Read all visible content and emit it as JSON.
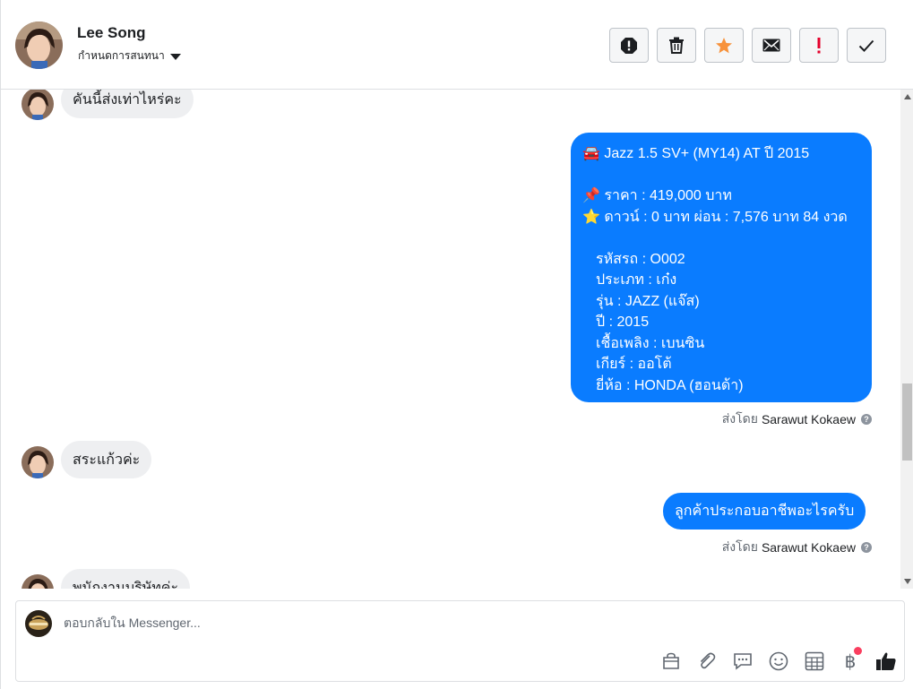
{
  "header": {
    "contact_name": "Lee Song",
    "assign_label": "กำหนดการสนทนา",
    "actions": [
      {
        "name": "spam-button",
        "icon": "alert-circle-icon"
      },
      {
        "name": "delete-button",
        "icon": "trash-icon"
      },
      {
        "name": "star-button",
        "icon": "star-icon"
      },
      {
        "name": "mark-unread-button",
        "icon": "envelope-icon"
      },
      {
        "name": "important-button",
        "icon": "exclamation-icon"
      },
      {
        "name": "mark-done-button",
        "icon": "check-icon"
      }
    ]
  },
  "messages": [
    {
      "from": "customer",
      "text": "คันนี้ส่งเท่าไหร่คะ"
    },
    {
      "from": "page",
      "lines": {
        "title": "🚘 Jazz 1.5 SV+ (MY14) AT ปี 2015",
        "price": "📌 ราคา : 419,000 บาท",
        "installment": "⭐ ดาวน์ : 0 บาท ผ่อน : 7,576 บาท 84 งวด",
        "code": "รหัสรถ : O002",
        "type": "ประเภท : เก๋ง",
        "model": "รุ่น : JAZZ (แจ๊ส)",
        "year": "ปี : 2015",
        "fuel": "เชื้อเพลิง : เบนซิน",
        "gear": "เกียร์ : ออโต้",
        "brand": "ยี่ห้อ : HONDA (ฮอนด้า)"
      },
      "sent_by_label": "ส่งโดย",
      "sent_by_name": "Sarawut Kokaew"
    },
    {
      "from": "customer",
      "text": "สระแก้วค่ะ"
    },
    {
      "from": "page",
      "text": "ลูกค้าประกอบอาชีพอะไรครับ",
      "sent_by_label": "ส่งโดย",
      "sent_by_name": "Sarawut Kokaew"
    },
    {
      "from": "customer",
      "text": "พนักงานบริษัทค่ะ"
    }
  ],
  "composer": {
    "placeholder": "ตอบกลับใน Messenger...",
    "tools": [
      "bag-icon",
      "paperclip-icon",
      "saved-reply-icon",
      "emoji-icon",
      "calculator-icon",
      "baht-icon",
      "thumbs-up-icon"
    ],
    "baht_symbol": "฿"
  },
  "colors": {
    "outgoing_bubble": "#0a7cff",
    "incoming_bubble": "#eeeff1",
    "star": "#f7923b",
    "important": "#e4002b",
    "notification_dot": "#fa3e5f"
  }
}
